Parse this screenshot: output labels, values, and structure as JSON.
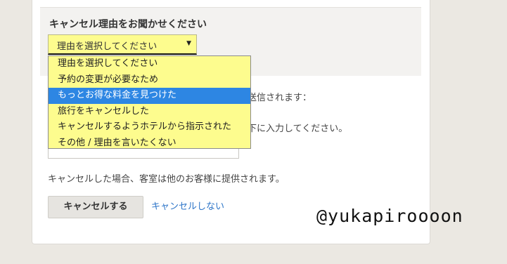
{
  "reason": {
    "title": "キャンセル理由をお聞かせください",
    "select_value": "理由を選択してください",
    "options": [
      "理由を選択してください",
      "予約の変更が必要なため",
      "もっとお得な料金を見つけた",
      "旅行をキャンセルした",
      "キャンセルするようホテルから指示された",
      "その他 / 理由を言いたくない"
    ],
    "highlighted_index": 2
  },
  "partial_texts": {
    "sent": "送信されます：",
    "enter_below": "下に入力してください。"
  },
  "notice": "キャンセルした場合、客室は他のお客様に提供されます。",
  "actions": {
    "cancel_label": "キャンセルする",
    "keep_label": "キャンセルしない"
  },
  "watermark": "@yukapiroooon",
  "colors": {
    "select_bg": "#fdfc8e",
    "highlight": "#2d86e3",
    "link": "#2d75c8",
    "page_bg": "#ebe8e2"
  }
}
